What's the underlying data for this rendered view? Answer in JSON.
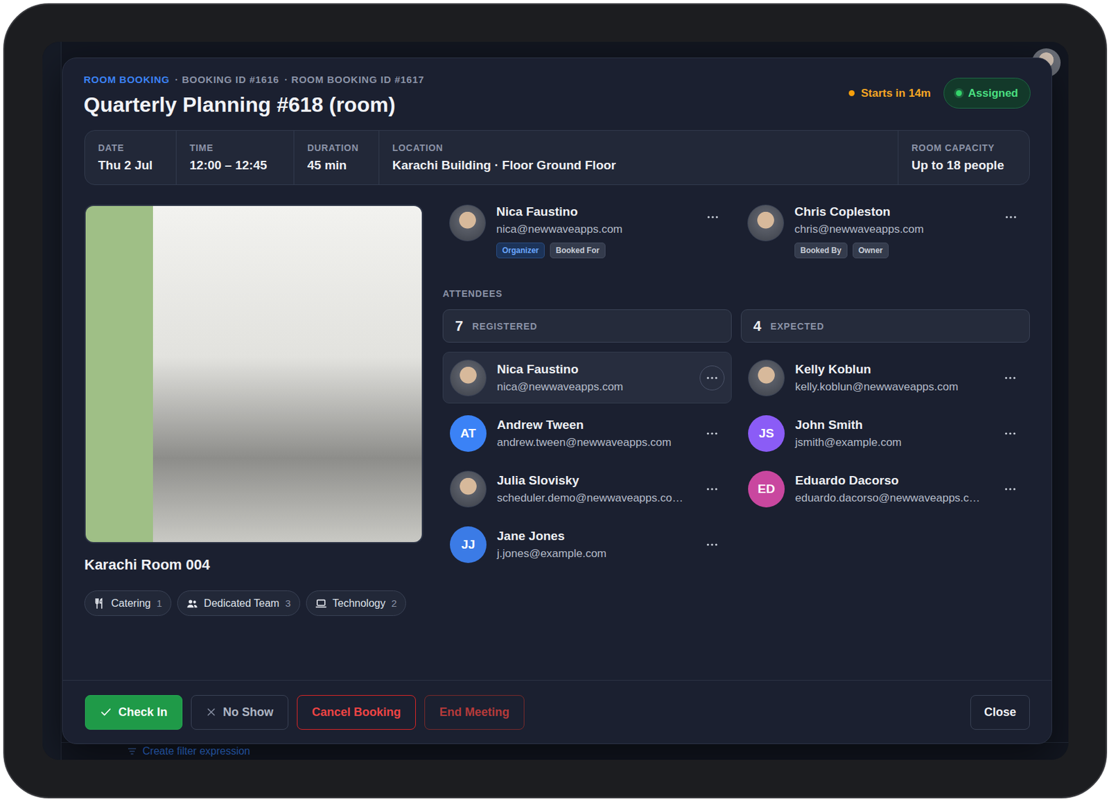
{
  "header": {
    "category": "ROOM BOOKING",
    "booking_id": "· BOOKING ID #1616",
    "room_booking_id": "· ROOM BOOKING ID #1617",
    "title": "Quarterly Planning #618 (room)",
    "countdown": "Starts in 14m",
    "status": "Assigned"
  },
  "details": [
    {
      "label": "DATE",
      "value": "Thu 2 Jul"
    },
    {
      "label": "TIME",
      "value": "12:00 – 12:45"
    },
    {
      "label": "DURATION",
      "value": "45 min"
    },
    {
      "label": "LOCATION",
      "value": "Karachi Building · Floor Ground Floor"
    },
    {
      "label": "ROOM CAPACITY",
      "value": "Up to 18 people"
    }
  ],
  "room": {
    "name": "Karachi Room 004"
  },
  "services": [
    {
      "kind": "catering",
      "label": "Catering",
      "count": "1"
    },
    {
      "kind": "team",
      "label": "Dedicated Team",
      "count": "3"
    },
    {
      "kind": "technology",
      "label": "Technology",
      "count": "2"
    }
  ],
  "people": [
    {
      "name": "Nica Faustino",
      "email": "nica@newwaveapps.com",
      "tags": [
        {
          "label": "Organizer",
          "kind": "accent"
        },
        {
          "label": "Booked For",
          "kind": "plain"
        }
      ]
    },
    {
      "name": "Chris Copleston",
      "email": "chris@newwaveapps.com",
      "tags": [
        {
          "label": "Booked By",
          "kind": "plain"
        },
        {
          "label": "Owner",
          "kind": "plain"
        }
      ]
    }
  ],
  "attendees": {
    "heading": "ATTENDEES",
    "groups": [
      {
        "count": "7",
        "label": "REGISTERED",
        "items": [
          {
            "name": "Nica Faustino",
            "email": "nica@newwaveapps.com",
            "avatar_kind": "photo",
            "selected": true
          },
          {
            "name": "Andrew Tween",
            "email": "andrew.tween@newwaveapps.com",
            "avatar_kind": "initials",
            "initials": "AT",
            "color": "#3b82f6",
            "selected": false
          },
          {
            "name": "Julia Slovisky",
            "email": "scheduler.demo@newwaveapps.co…",
            "avatar_kind": "photo",
            "selected": false
          },
          {
            "name": "Jane Jones",
            "email": "j.jones@example.com",
            "avatar_kind": "initials",
            "initials": "JJ",
            "color": "#3b7be6",
            "selected": false
          }
        ]
      },
      {
        "count": "4",
        "label": "EXPECTED",
        "items": [
          {
            "name": "Kelly Koblun",
            "email": "kelly.koblun@newwaveapps.com",
            "avatar_kind": "photo",
            "selected": false
          },
          {
            "name": "John Smith",
            "email": "jsmith@example.com",
            "avatar_kind": "initials",
            "initials": "JS",
            "color": "#8b5cf6",
            "selected": false
          },
          {
            "name": "Eduardo Dacorso",
            "email": "eduardo.dacorso@newwaveapps.c…",
            "avatar_kind": "initials",
            "initials": "ED",
            "color": "#c9479f",
            "selected": false
          }
        ]
      }
    ]
  },
  "actions": [
    {
      "label": "Check In",
      "kind": "success",
      "disabled": false
    },
    {
      "label": "No Show",
      "kind": "neutral",
      "disabled": false
    },
    {
      "label": "Cancel Booking",
      "kind": "danger",
      "disabled": false
    },
    {
      "label": "End Meeting",
      "kind": "danger",
      "disabled": true
    }
  ],
  "close": {
    "label": "Close"
  },
  "background": {
    "filter_link": "Create filter expression"
  }
}
